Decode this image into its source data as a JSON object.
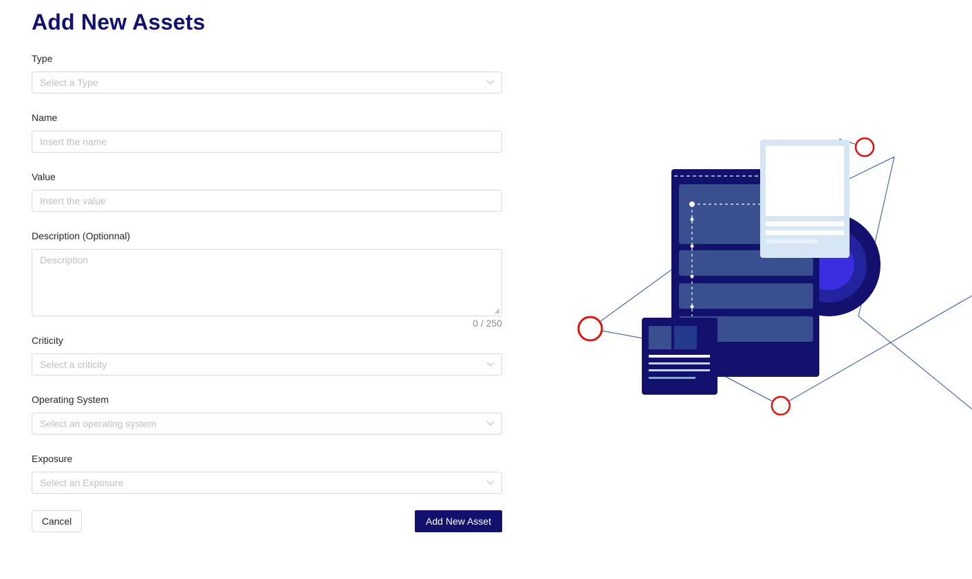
{
  "page": {
    "title": "Add New Assets"
  },
  "form": {
    "type": {
      "label": "Type",
      "placeholder": "Select a Type"
    },
    "name": {
      "label": "Name",
      "placeholder": "Insert the name"
    },
    "value": {
      "label": "Value",
      "placeholder": "Insert the value"
    },
    "description": {
      "label": "Description (Optionnal)",
      "placeholder": "Description",
      "counter": "0 / 250"
    },
    "criticity": {
      "label": "Criticity",
      "placeholder": "Select a criticity"
    },
    "operating_system": {
      "label": "Operating System",
      "placeholder": "Select an operating system"
    },
    "exposure": {
      "label": "Exposure",
      "placeholder": "Select an Exposure"
    }
  },
  "actions": {
    "cancel_label": "Cancel",
    "submit_label": "Add New Asset"
  },
  "colors": {
    "brand": "#13116e",
    "border": "#d9d9d9",
    "placeholder": "#bfbfbf",
    "accent_red": "#e0110b",
    "accent_blue": "#3a2ee0"
  },
  "icons": {
    "select_arrow": "chevron-down-icon",
    "illustration": "asset-servers-illustration"
  }
}
